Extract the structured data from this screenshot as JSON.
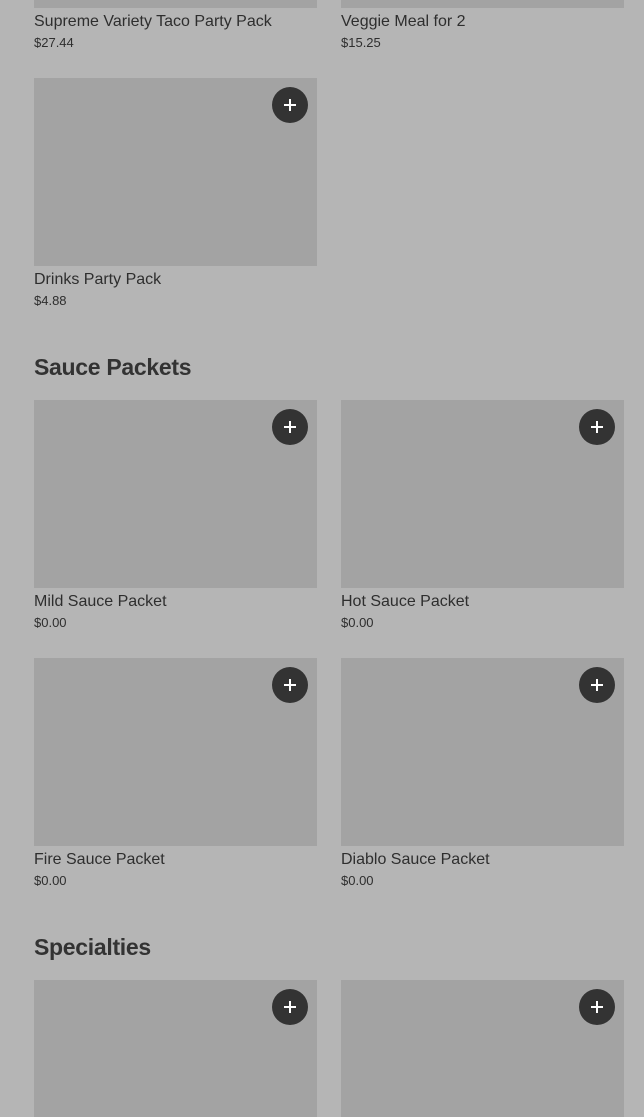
{
  "sections": [
    {
      "items": [
        {
          "name": "Supreme Variety Taco Party Pack",
          "price": "$27.44"
        },
        {
          "name": "Veggie Meal for 2",
          "price": "$15.25"
        },
        {
          "name": "Drinks Party Pack",
          "price": "$4.88"
        }
      ]
    },
    {
      "title": "Sauce Packets",
      "items": [
        {
          "name": "Mild Sauce Packet",
          "price": "$0.00"
        },
        {
          "name": "Hot Sauce Packet",
          "price": "$0.00"
        },
        {
          "name": "Fire Sauce Packet",
          "price": "$0.00"
        },
        {
          "name": "Diablo Sauce Packet",
          "price": "$0.00"
        }
      ]
    },
    {
      "title": "Specialties",
      "items": [
        {
          "name": "",
          "price": ""
        },
        {
          "name": "",
          "price": ""
        }
      ]
    }
  ],
  "colors": {
    "page_background": "#b5b5b5",
    "image_placeholder": "#a3a3a3",
    "add_button": "#333333",
    "add_icon": "#ffffff"
  },
  "icons": {
    "add": "plus-icon"
  }
}
